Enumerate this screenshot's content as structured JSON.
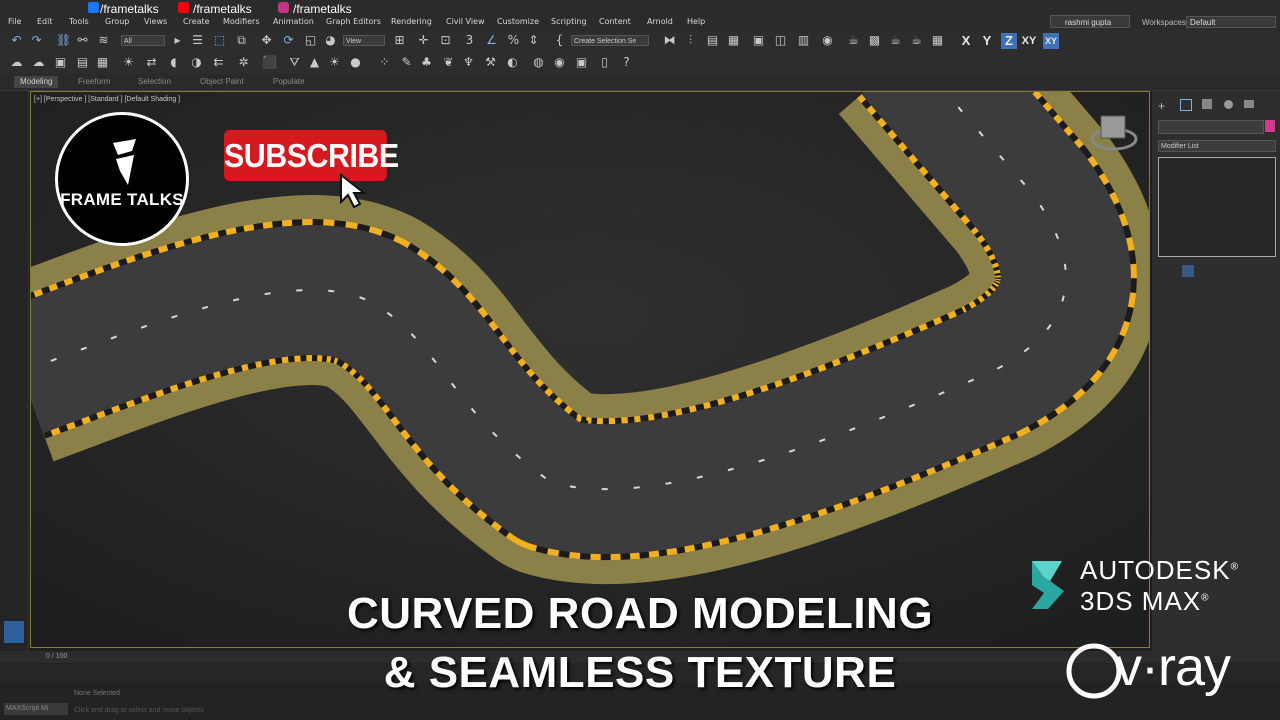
{
  "menu": {
    "items": [
      "File",
      "Edit",
      "Tools",
      "Group",
      "Views",
      "Create",
      "Modifiers",
      "Animation",
      "Graph Editors",
      "Rendering",
      "Civil View",
      "Customize",
      "Scripting",
      "Content",
      "Arnold",
      "Help"
    ],
    "user": "rashmi gupta",
    "workspaces_label": "Workspaces:",
    "workspace_value": "Default"
  },
  "social": {
    "facebook": "/frametalks",
    "youtube": "/frametalks",
    "instagram": "/frametalks"
  },
  "toolbar": {
    "filter_value": "All",
    "coord_value": "View",
    "selection_set_placeholder": "Create Selection Se",
    "axes": [
      "X",
      "Y",
      "Z",
      "XY",
      "XY"
    ]
  },
  "ribbon": {
    "tabs": [
      "Modeling",
      "Freeform",
      "Selection",
      "Object Paint",
      "Populate"
    ]
  },
  "viewport": {
    "label": "[+] [Perspective ] [Standard ] [Default Shading ]"
  },
  "command_panel": {
    "modifier_list": "Modifier List"
  },
  "timeline": {
    "frame": "0 / 100",
    "status_selected": "None Selected",
    "status_hint": "Click and drag to select and move objects",
    "maxscript": "MAXScript Mi"
  },
  "overlay": {
    "logo_text": "FRAME TALKS",
    "subscribe": "SUBSCRIBE",
    "title_line1": "CURVED ROAD MODELING",
    "title_line2": "& SEAMLESS TEXTURE",
    "autodesk_line1": "AUTODESK",
    "autodesk_line2": "3DS MAX",
    "registered": "®",
    "vray": "v·ray"
  },
  "colors": {
    "accent_blue": "#3d72b8",
    "subscribe_red": "#d6181f",
    "road_edge_yellow": "#f2b01e",
    "shoulder_grass": "#8a8048",
    "asphalt": "#3c3c3e"
  }
}
